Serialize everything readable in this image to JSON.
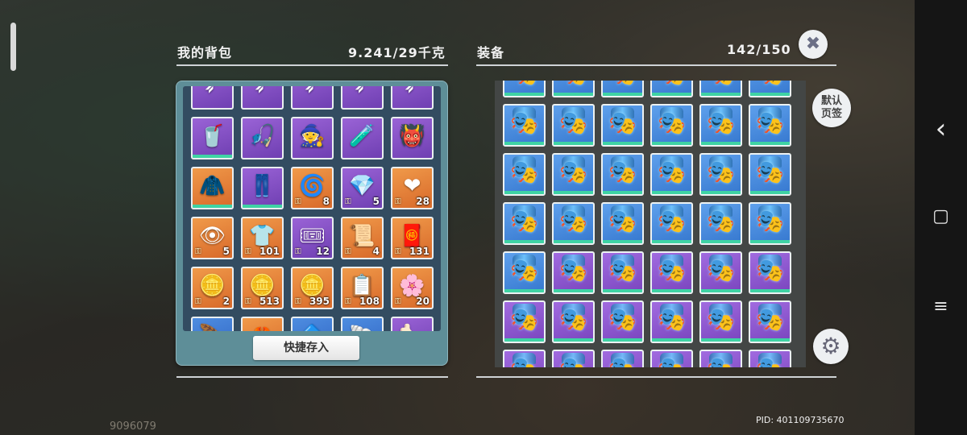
{
  "backpack": {
    "title": "我的背包",
    "weight": "9.241/29千克",
    "quick_store_label": "快捷存入",
    "items": [
      {
        "color": "purple",
        "glyph": "➶",
        "qty": "",
        "bar": false
      },
      {
        "color": "purple",
        "glyph": "➶",
        "qty": "",
        "bar": false
      },
      {
        "color": "purple",
        "glyph": "➶",
        "qty": "",
        "bar": false
      },
      {
        "color": "purple",
        "glyph": "➶",
        "qty": "",
        "bar": false
      },
      {
        "color": "purple",
        "glyph": "➶",
        "qty": "",
        "bar": false
      },
      {
        "color": "purple",
        "glyph": "🥤",
        "qty": "",
        "bar": true
      },
      {
        "color": "purple",
        "glyph": "🎣",
        "qty": "",
        "bar": false
      },
      {
        "color": "purple",
        "glyph": "🧙",
        "qty": "",
        "bar": false
      },
      {
        "color": "purple",
        "glyph": "🧪",
        "qty": "",
        "bar": false
      },
      {
        "color": "purple",
        "glyph": "👹",
        "qty": "",
        "bar": false
      },
      {
        "color": "orange",
        "glyph": "🧥",
        "qty": "",
        "bar": true
      },
      {
        "color": "purple",
        "glyph": "👖",
        "qty": "",
        "bar": true
      },
      {
        "color": "orange",
        "glyph": "🌀",
        "qty": "8",
        "bar": false
      },
      {
        "color": "purple",
        "glyph": "💎",
        "qty": "5",
        "bar": false
      },
      {
        "color": "orange",
        "glyph": "❤",
        "qty": "28",
        "bar": false
      },
      {
        "color": "orange",
        "glyph": "👁",
        "qty": "5",
        "bar": false
      },
      {
        "color": "orange",
        "glyph": "👕",
        "qty": "101",
        "bar": false
      },
      {
        "color": "purple",
        "glyph": "🎟",
        "qty": "12",
        "bar": false
      },
      {
        "color": "orange",
        "glyph": "📜",
        "qty": "4",
        "bar": false
      },
      {
        "color": "orange",
        "glyph": "🧧",
        "qty": "131",
        "bar": false
      },
      {
        "color": "orange",
        "glyph": "🪙",
        "qty": "2",
        "bar": false
      },
      {
        "color": "orange",
        "glyph": "🪙",
        "qty": "513",
        "bar": false
      },
      {
        "color": "orange",
        "glyph": "🪙",
        "qty": "395",
        "bar": false
      },
      {
        "color": "orange",
        "glyph": "📋",
        "qty": "108",
        "bar": false
      },
      {
        "color": "orange",
        "glyph": "🌸",
        "qty": "20",
        "bar": false
      },
      {
        "color": "blue",
        "glyph": "🪶",
        "qty": "",
        "bar": false
      },
      {
        "color": "orange",
        "glyph": "🦀",
        "qty": "",
        "bar": false
      },
      {
        "color": "blue",
        "glyph": "🔷",
        "qty": "",
        "bar": false
      },
      {
        "color": "blue",
        "glyph": "🐚",
        "qty": "",
        "bar": false
      },
      {
        "color": "purple",
        "glyph": "🦴",
        "qty": "",
        "bar": false
      }
    ]
  },
  "equipment": {
    "title": "装备",
    "count": "142/150",
    "items": [
      "blue",
      "blue",
      "blue",
      "blue",
      "blue",
      "blue",
      "blue",
      "blue",
      "blue",
      "blue",
      "blue",
      "blue",
      "blue",
      "blue",
      "blue",
      "blue",
      "blue",
      "blue",
      "blue",
      "blue",
      "blue",
      "blue",
      "blue",
      "blue",
      "blue",
      "purple",
      "purple",
      "purple",
      "purple",
      "purple",
      "purple",
      "purple",
      "purple",
      "purple",
      "purple",
      "purple",
      "purple",
      "purple",
      "purple",
      "purple",
      "purple",
      "purple"
    ]
  },
  "buttons": {
    "close_icon": "✖",
    "default_page_label_1": "默认",
    "default_page_label_2": "页签",
    "settings_icon": "⚙"
  },
  "footer": {
    "bottom_id": "9096079",
    "pid": "PID: 401109735670"
  },
  "nav": {
    "back_icon": "‹",
    "home_icon": "▢",
    "menu_icon": "≡"
  }
}
